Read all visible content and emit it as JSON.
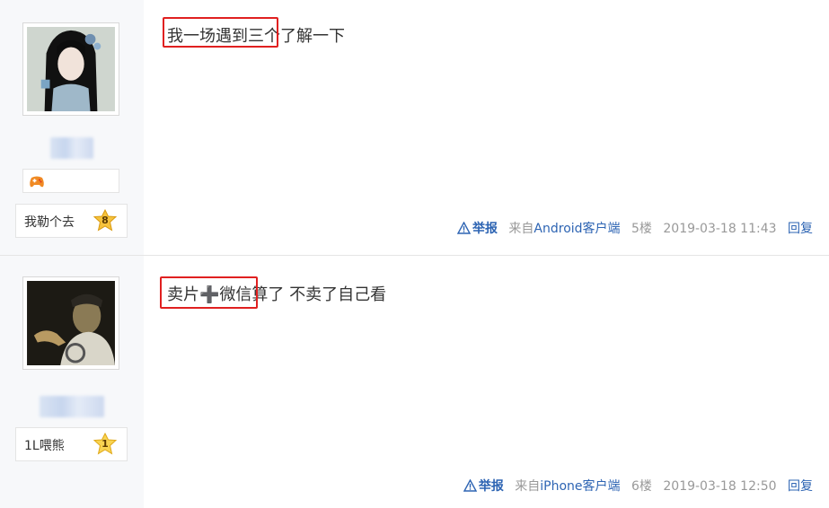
{
  "posts": [
    {
      "user_badge": "我勒个去",
      "level": "8",
      "content": "我一场遇到三个了解一下",
      "report": "举报",
      "source_prefix": "来自",
      "source_client": "Android客户端",
      "floor": "5楼",
      "time": "2019-03-18 11:43",
      "reply": "回复"
    },
    {
      "user_badge": "1L喂熊",
      "level": "1",
      "content_part1": "卖片",
      "content_plus": "➕",
      "content_part2": "微信",
      "content_part3": "算了 不卖了自己看",
      "report": "举报",
      "source_prefix": "来自",
      "source_client": "iPhone客户端",
      "floor": "6楼",
      "time": "2019-03-18 12:50",
      "reply": "回复"
    }
  ],
  "colors": {
    "highlight": "#e02020",
    "link": "#2d64b3",
    "sidebar_bg": "#f7f8fa",
    "meta": "#999999"
  }
}
